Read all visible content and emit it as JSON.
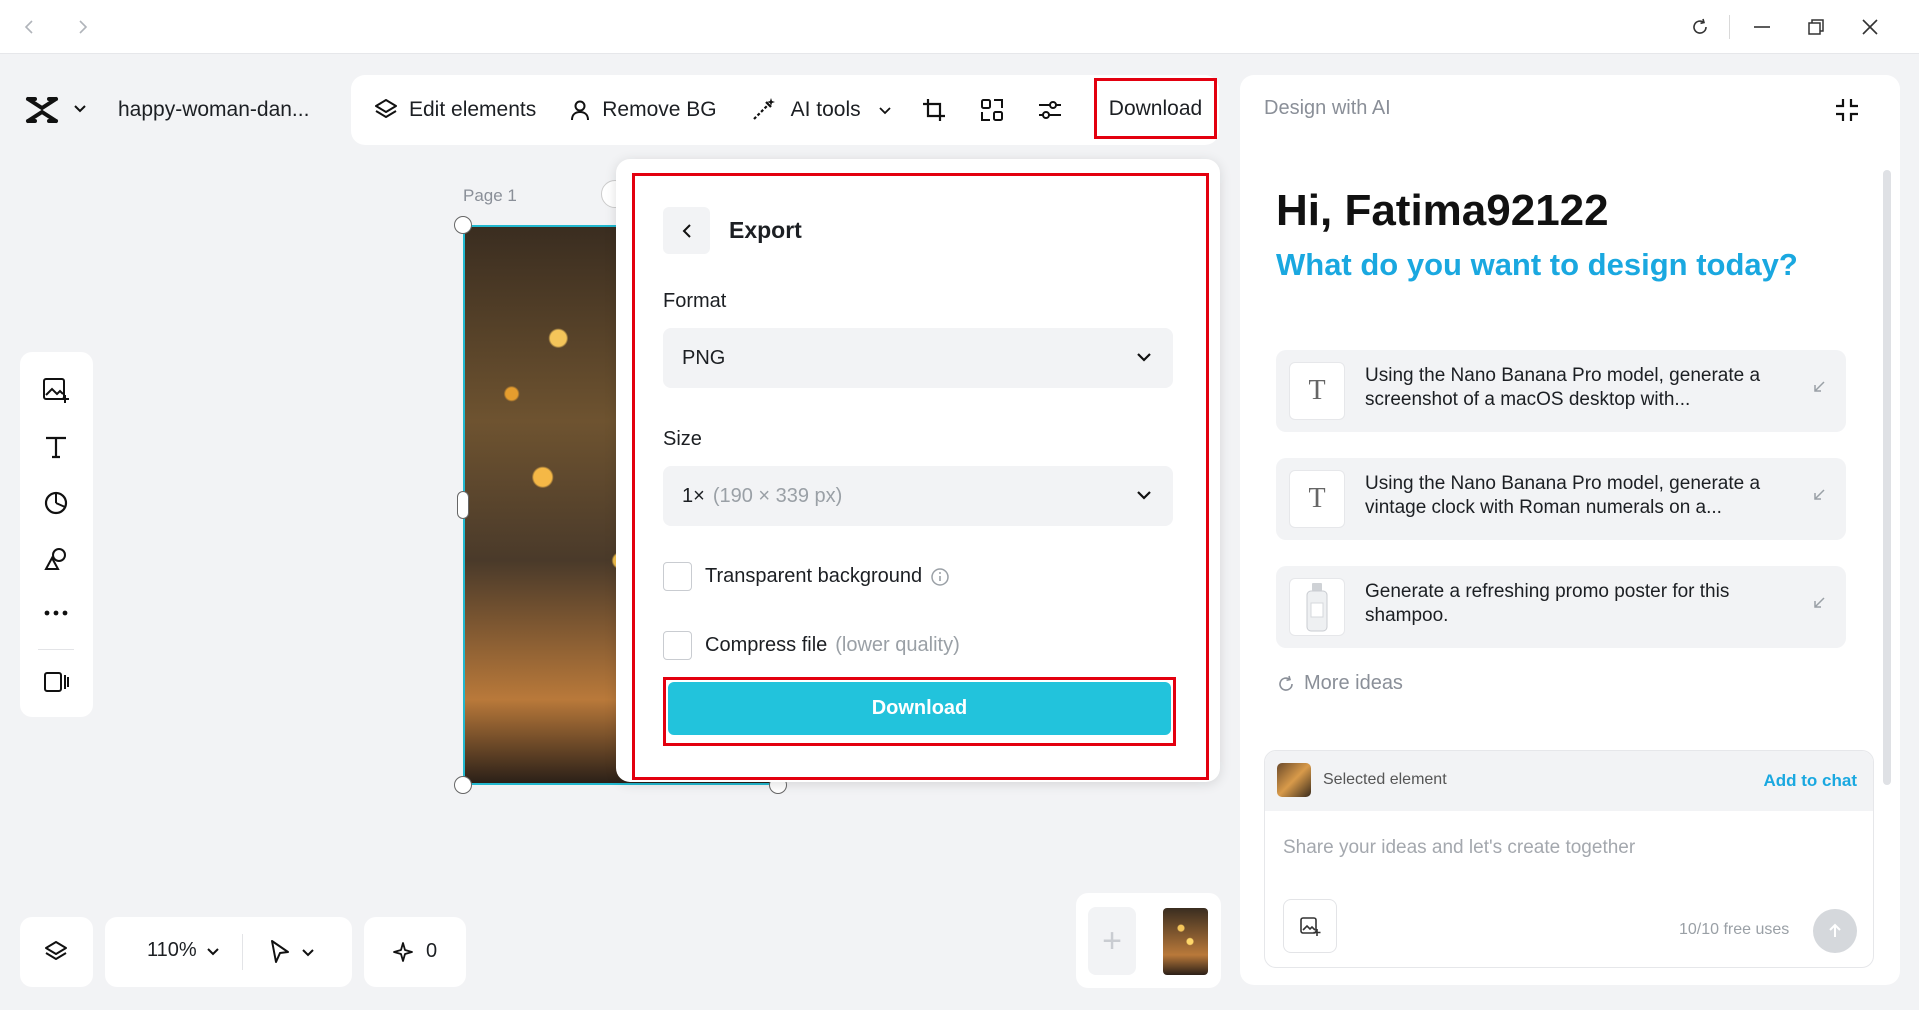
{
  "document": {
    "title": "happy-woman-dan...",
    "page_label": "Page 1"
  },
  "toolbar": {
    "edit_elements": "Edit elements",
    "remove_bg": "Remove BG",
    "ai_tools": "AI tools",
    "download": "Download"
  },
  "export": {
    "title": "Export",
    "format_label": "Format",
    "format_value": "PNG",
    "size_label": "Size",
    "size_value": "1×",
    "size_detail": "(190 × 339 px)",
    "transparent_label": "Transparent background",
    "transparent_checked": false,
    "compress_label": "Compress file",
    "compress_note": "(lower quality)",
    "compress_checked": false,
    "download_button": "Download"
  },
  "ai_panel": {
    "header": "Design with AI",
    "greeting": "Hi, Fatima92122",
    "subgreeting": "What do you want to design today?",
    "ideas": [
      {
        "icon": "text-icon",
        "text": "Using the Nano Banana Pro model, generate a screenshot of a macOS desktop with..."
      },
      {
        "icon": "text-icon",
        "text": "Using the Nano Banana Pro model, generate a vintage clock with Roman numerals on a..."
      },
      {
        "icon": "shampoo-thumbnail",
        "text": "Generate a refreshing promo poster for this shampoo."
      }
    ],
    "more_ideas": "More ideas",
    "selected_element": "Selected element",
    "add_to_chat": "Add to chat",
    "chat_placeholder": "Share your ideas and let's create together",
    "free_uses": "10/10 free uses"
  },
  "bottom": {
    "zoom": "110%",
    "ai_credits": "0"
  },
  "colors": {
    "accent": "#22c3dc",
    "highlight_outline": "#e3000f",
    "link": "#1aa8e0"
  }
}
